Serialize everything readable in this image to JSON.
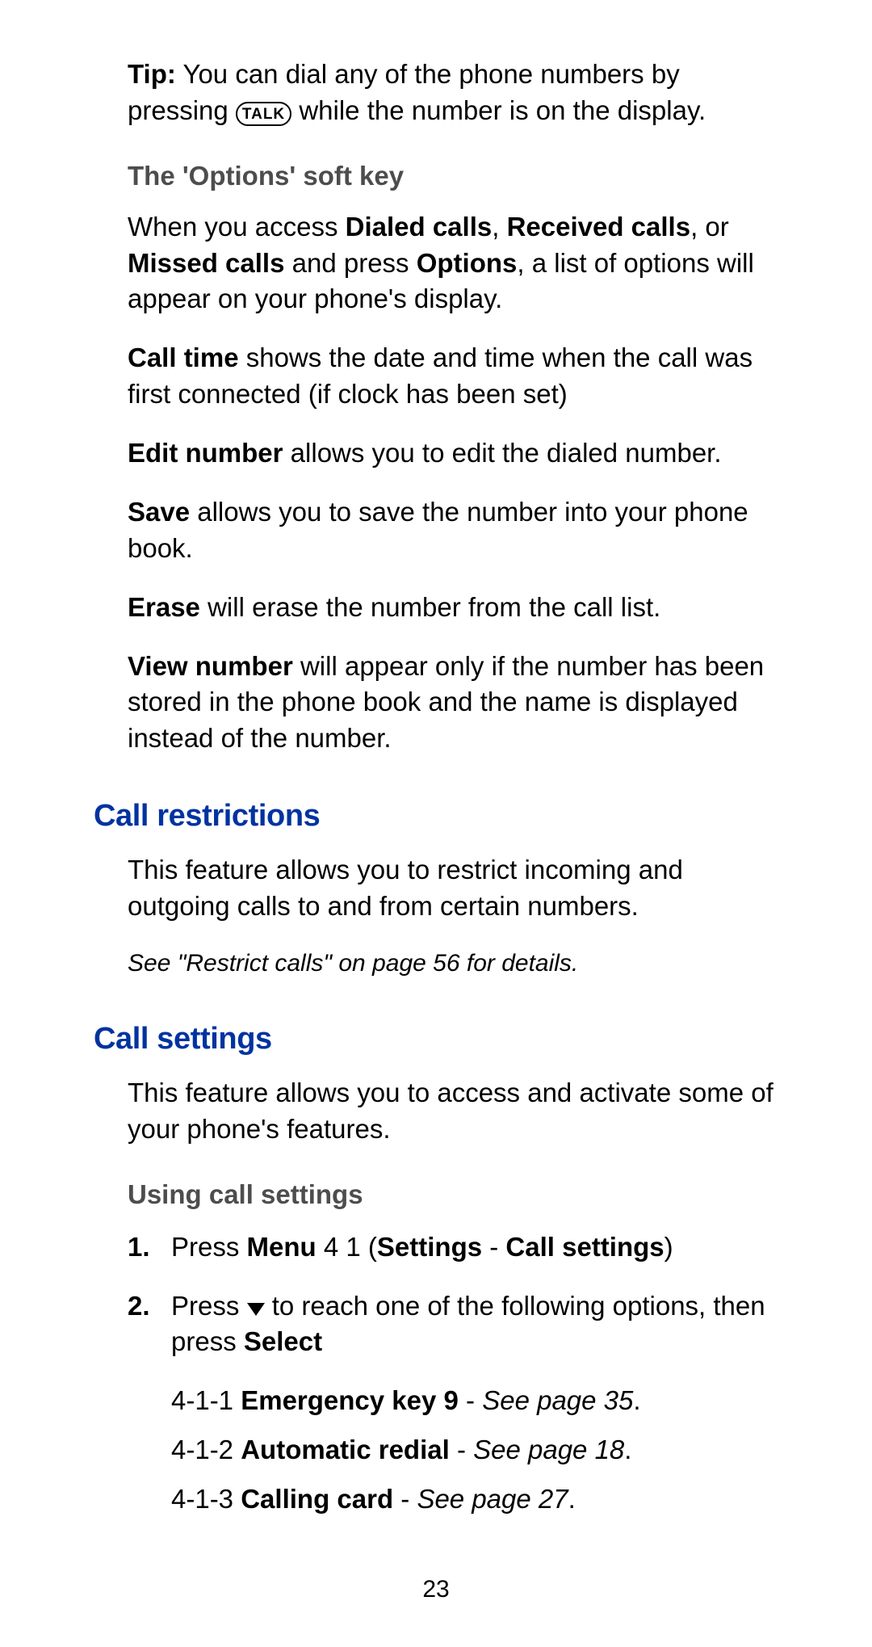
{
  "tip": {
    "label": "Tip:",
    "text_before": "You can dial any of the phone numbers by pressing",
    "button": "TALK",
    "text_after": "while the number is on the display."
  },
  "options_key": {
    "heading": "The 'Options' soft key",
    "intro": [
      "When you access ",
      "Dialed calls",
      ", ",
      "Received calls",
      ", or ",
      "Missed calls",
      " and press ",
      "Options",
      ", a list of options will appear on your phone's display."
    ],
    "items": [
      {
        "label": "Call time",
        "text": " shows the date and time when the call was first connected (if clock has been set)"
      },
      {
        "label": "Edit number",
        "text": " allows you to edit the dialed number."
      },
      {
        "label": "Save",
        "text": " allows you to save the number into your phone book."
      },
      {
        "label": "Erase",
        "text": " will erase the number from the call list."
      },
      {
        "label": "View number",
        "text": " will appear only if the number has been stored in the phone book and the name is displayed instead of the number."
      }
    ]
  },
  "call_restrictions": {
    "heading": "Call restrictions",
    "body": "This feature allows you to restrict incoming and outgoing calls to and from certain numbers.",
    "ref": "See \"Restrict calls\" on page 56 for details."
  },
  "call_settings": {
    "heading": "Call settings",
    "body": "This feature allows you to access and activate some of your phone's features.",
    "using": {
      "heading": "Using call settings",
      "steps": [
        {
          "num": "1.",
          "parts": [
            "Press ",
            "Menu",
            " 4 1 (",
            "Settings",
            " - ",
            "Call settings",
            ")"
          ]
        },
        {
          "num": "2.",
          "parts_before": "Press ",
          "arrow": true,
          "parts_mid": " to reach one of the following options, then press ",
          "bold_end": "Select"
        }
      ],
      "menu_items": [
        {
          "code": "4-1-1 ",
          "label": "Emergency key 9",
          "sep": " - ",
          "ref": "See page 35",
          "tail": "."
        },
        {
          "code": "4-1-2 ",
          "label": "Automatic redial",
          "sep": " - ",
          "ref": "See page 18",
          "tail": "."
        },
        {
          "code": "4-1-3 ",
          "label": "Calling card",
          "sep": " - ",
          "ref": "See page 27",
          "tail": "."
        }
      ]
    }
  },
  "page_number": "23"
}
